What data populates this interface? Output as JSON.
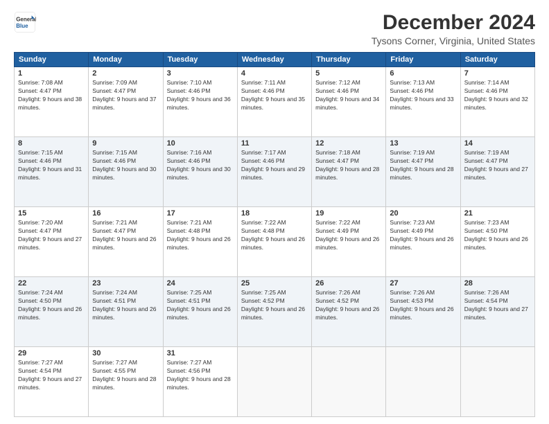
{
  "header": {
    "logo": {
      "line1": "General",
      "line2": "Blue"
    },
    "title": "December 2024",
    "location": "Tysons Corner, Virginia, United States"
  },
  "weekdays": [
    "Sunday",
    "Monday",
    "Tuesday",
    "Wednesday",
    "Thursday",
    "Friday",
    "Saturday"
  ],
  "weeks": [
    [
      {
        "day": "1",
        "sunrise": "7:08 AM",
        "sunset": "4:47 PM",
        "daylight": "9 hours and 38 minutes."
      },
      {
        "day": "2",
        "sunrise": "7:09 AM",
        "sunset": "4:47 PM",
        "daylight": "9 hours and 37 minutes."
      },
      {
        "day": "3",
        "sunrise": "7:10 AM",
        "sunset": "4:46 PM",
        "daylight": "9 hours and 36 minutes."
      },
      {
        "day": "4",
        "sunrise": "7:11 AM",
        "sunset": "4:46 PM",
        "daylight": "9 hours and 35 minutes."
      },
      {
        "day": "5",
        "sunrise": "7:12 AM",
        "sunset": "4:46 PM",
        "daylight": "9 hours and 34 minutes."
      },
      {
        "day": "6",
        "sunrise": "7:13 AM",
        "sunset": "4:46 PM",
        "daylight": "9 hours and 33 minutes."
      },
      {
        "day": "7",
        "sunrise": "7:14 AM",
        "sunset": "4:46 PM",
        "daylight": "9 hours and 32 minutes."
      }
    ],
    [
      {
        "day": "8",
        "sunrise": "7:15 AM",
        "sunset": "4:46 PM",
        "daylight": "9 hours and 31 minutes."
      },
      {
        "day": "9",
        "sunrise": "7:15 AM",
        "sunset": "4:46 PM",
        "daylight": "9 hours and 30 minutes."
      },
      {
        "day": "10",
        "sunrise": "7:16 AM",
        "sunset": "4:46 PM",
        "daylight": "9 hours and 30 minutes."
      },
      {
        "day": "11",
        "sunrise": "7:17 AM",
        "sunset": "4:46 PM",
        "daylight": "9 hours and 29 minutes."
      },
      {
        "day": "12",
        "sunrise": "7:18 AM",
        "sunset": "4:47 PM",
        "daylight": "9 hours and 28 minutes."
      },
      {
        "day": "13",
        "sunrise": "7:19 AM",
        "sunset": "4:47 PM",
        "daylight": "9 hours and 28 minutes."
      },
      {
        "day": "14",
        "sunrise": "7:19 AM",
        "sunset": "4:47 PM",
        "daylight": "9 hours and 27 minutes."
      }
    ],
    [
      {
        "day": "15",
        "sunrise": "7:20 AM",
        "sunset": "4:47 PM",
        "daylight": "9 hours and 27 minutes."
      },
      {
        "day": "16",
        "sunrise": "7:21 AM",
        "sunset": "4:47 PM",
        "daylight": "9 hours and 26 minutes."
      },
      {
        "day": "17",
        "sunrise": "7:21 AM",
        "sunset": "4:48 PM",
        "daylight": "9 hours and 26 minutes."
      },
      {
        "day": "18",
        "sunrise": "7:22 AM",
        "sunset": "4:48 PM",
        "daylight": "9 hours and 26 minutes."
      },
      {
        "day": "19",
        "sunrise": "7:22 AM",
        "sunset": "4:49 PM",
        "daylight": "9 hours and 26 minutes."
      },
      {
        "day": "20",
        "sunrise": "7:23 AM",
        "sunset": "4:49 PM",
        "daylight": "9 hours and 26 minutes."
      },
      {
        "day": "21",
        "sunrise": "7:23 AM",
        "sunset": "4:50 PM",
        "daylight": "9 hours and 26 minutes."
      }
    ],
    [
      {
        "day": "22",
        "sunrise": "7:24 AM",
        "sunset": "4:50 PM",
        "daylight": "9 hours and 26 minutes."
      },
      {
        "day": "23",
        "sunrise": "7:24 AM",
        "sunset": "4:51 PM",
        "daylight": "9 hours and 26 minutes."
      },
      {
        "day": "24",
        "sunrise": "7:25 AM",
        "sunset": "4:51 PM",
        "daylight": "9 hours and 26 minutes."
      },
      {
        "day": "25",
        "sunrise": "7:25 AM",
        "sunset": "4:52 PM",
        "daylight": "9 hours and 26 minutes."
      },
      {
        "day": "26",
        "sunrise": "7:26 AM",
        "sunset": "4:52 PM",
        "daylight": "9 hours and 26 minutes."
      },
      {
        "day": "27",
        "sunrise": "7:26 AM",
        "sunset": "4:53 PM",
        "daylight": "9 hours and 26 minutes."
      },
      {
        "day": "28",
        "sunrise": "7:26 AM",
        "sunset": "4:54 PM",
        "daylight": "9 hours and 27 minutes."
      }
    ],
    [
      {
        "day": "29",
        "sunrise": "7:27 AM",
        "sunset": "4:54 PM",
        "daylight": "9 hours and 27 minutes."
      },
      {
        "day": "30",
        "sunrise": "7:27 AM",
        "sunset": "4:55 PM",
        "daylight": "9 hours and 28 minutes."
      },
      {
        "day": "31",
        "sunrise": "7:27 AM",
        "sunset": "4:56 PM",
        "daylight": "9 hours and 28 minutes."
      },
      null,
      null,
      null,
      null
    ]
  ]
}
